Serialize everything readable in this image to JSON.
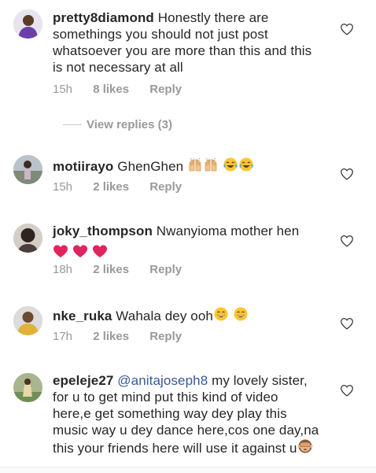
{
  "comments": [
    {
      "username": "pretty8diamond",
      "text": "Honestly there are somethings you should not just post whatsoever you are more than this and this is not necessary at all",
      "time": "15h",
      "likes": "8 likes",
      "reply": "Reply",
      "avatar_color": "#7a4fa0"
    },
    {
      "username": "motiirayo",
      "text": "GhenGhen",
      "emojis": [
        "raising-hands-icon",
        "raising-hands-icon",
        "tears-of-joy-icon",
        "tears-of-joy-icon"
      ],
      "time": "15h",
      "likes": "2 likes",
      "reply": "Reply",
      "avatar_color": "#8b97a6"
    },
    {
      "username": "joky_thompson",
      "text": "Nwanyioma mother hen",
      "emojis": [
        "red-heart-icon",
        "red-heart-icon",
        "red-heart-icon"
      ],
      "time": "18h",
      "likes": "2 likes",
      "reply": "Reply",
      "avatar_color": "#3d3a37"
    },
    {
      "username": "nke_ruka",
      "text": "Wahala dey ooh",
      "emojis": [
        "grinning-face-icon",
        "grinning-face-icon"
      ],
      "time": "17h",
      "likes": "2 likes",
      "reply": "Reply",
      "avatar_color": "#c8a060"
    },
    {
      "username": "epeleje27",
      "mention": "@anitajoseph8",
      "text": "my lovely sister, for u to get mind put this kind of video here,e get something way dey play this music way u dey dance here,cos one day,na this your friends here will use it against u",
      "emojis": [
        "see-no-evil-monkey-icon"
      ],
      "avatar_color": "#6f8f55"
    }
  ],
  "view_replies": "View replies (3)",
  "colors": {
    "text": "#262626",
    "meta": "#999999",
    "mention": "#385898",
    "heart_emoji": "#e0245e"
  }
}
